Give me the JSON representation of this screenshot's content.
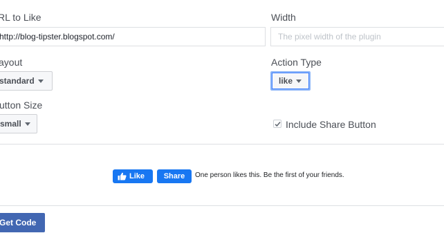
{
  "form": {
    "url_label": "RL to Like",
    "url_value": "http://blog-tipster.blogspot.com/",
    "width_label": "Width",
    "width_placeholder": "The pixel width of the plugin",
    "layout_label": "ayout",
    "layout_value": "standard",
    "action_label": "Action Type",
    "action_value": "like",
    "size_label": "utton Size",
    "size_value": "small",
    "share_label": "Include Share Button",
    "share_checked": true
  },
  "preview": {
    "like_label": "Like",
    "share_label": "Share",
    "social_text": "One person likes this. Be the first of your friends."
  },
  "footer": {
    "get_code_label": "Get Code"
  },
  "colors": {
    "facebook_blue": "#1877f2",
    "button_blue": "#4267b2"
  }
}
